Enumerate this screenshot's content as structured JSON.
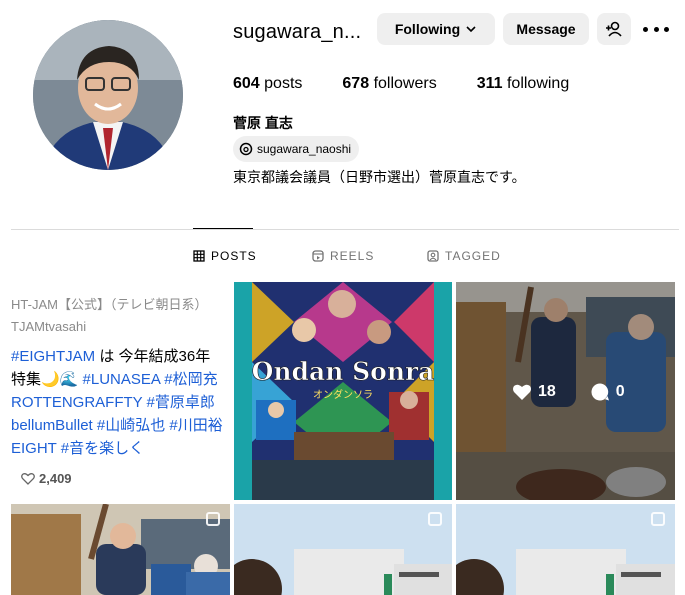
{
  "profile": {
    "username": "sugawara_n...",
    "following_label": "Following",
    "message_label": "Message",
    "posts_count": "604",
    "posts_label": "posts",
    "followers_count": "678",
    "followers_label": "followers",
    "following_count": "311",
    "following_stat_label": "following",
    "full_name": "菅原 直志",
    "threads_handle": "sugawara_naoshi",
    "bio": "東京都議会議員（日野市選出）菅原直志です。"
  },
  "tabs": [
    {
      "label": "POSTS",
      "icon": "grid-icon"
    },
    {
      "label": "REELS",
      "icon": "reels-icon"
    },
    {
      "label": "TAGGED",
      "icon": "tagged-icon"
    }
  ],
  "posts": {
    "tweet": {
      "line1": "HT-JAM【公式】（テレビ朝日系）",
      "line2": "TJAMtvasahi",
      "line3a": "#EIGHTJAM",
      "line3b": " は 今年結成36年",
      "line4a": "特集🌙🌊 ",
      "line4b": "#LUNASEA #松岡充",
      "line5": "ROTTENGRAFFTY #菅原卓郎",
      "line6": "bellumBullet #山崎弘也 #川田裕",
      "line7": "EIGHT #音を楽しく",
      "likes": "2,409"
    },
    "poster_title": "Ondan Sonra",
    "poster_subtitle": "オンダンソラ",
    "photo_likes": "18",
    "photo_comments": "0"
  },
  "colors": {
    "accent_blue": "#1d5fd6",
    "button_bg": "#efefef",
    "divider": "#dbdbdb",
    "muted_text": "#737373"
  }
}
